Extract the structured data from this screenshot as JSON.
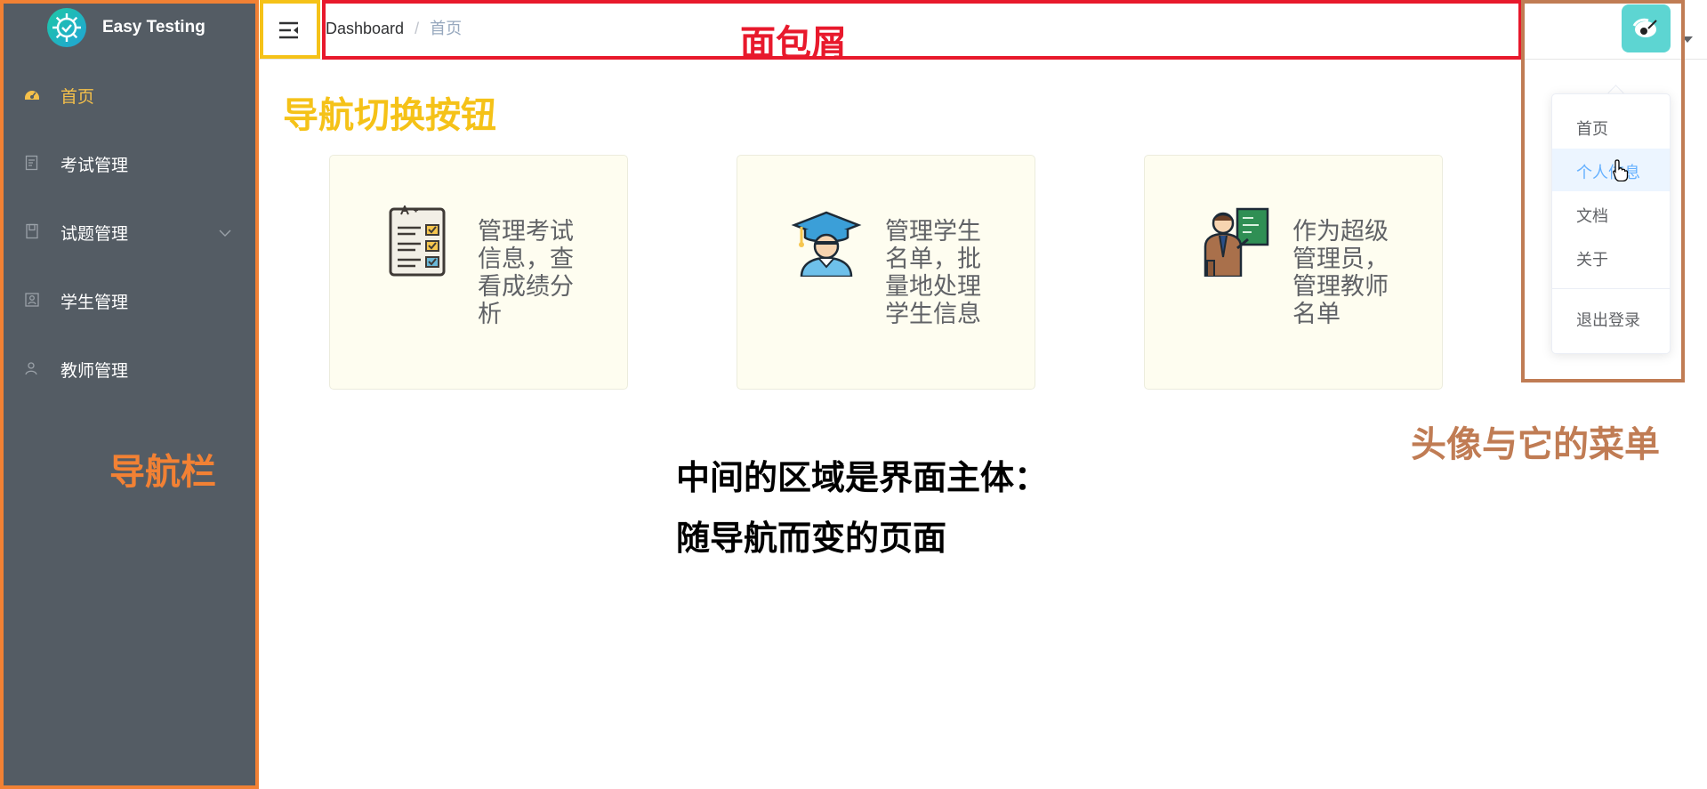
{
  "sidebar": {
    "brand": {
      "title": "Easy Testing"
    },
    "items": [
      {
        "label": "首页",
        "icon": "dashboard-icon",
        "active": true
      },
      {
        "label": "考试管理",
        "icon": "exam-icon"
      },
      {
        "label": "试题管理",
        "icon": "question-bank-icon",
        "has_submenu": true
      },
      {
        "label": "学生管理",
        "icon": "student-icon"
      },
      {
        "label": "教师管理",
        "icon": "teacher-icon"
      }
    ]
  },
  "header": {
    "breadcrumb": {
      "root": "Dashboard",
      "separator": "/",
      "current": "首页"
    },
    "toggle_icon": "menu-fold-icon",
    "avatar_icon": "avatar-icon"
  },
  "dropdown": {
    "items": [
      {
        "label": "首页"
      },
      {
        "label": "个人信息",
        "hover": true
      },
      {
        "label": "文档"
      },
      {
        "label": "关于"
      },
      {
        "label": "退出登录"
      }
    ]
  },
  "cards": [
    {
      "text": "管理考试信息，查看成绩分析",
      "icon": "exam-paper-icon"
    },
    {
      "text": "管理学生名单，批量地处理学生信息",
      "icon": "graduate-student-icon"
    },
    {
      "text": "作为超级管理员，管理教师名单",
      "icon": "teacher-presenting-icon"
    }
  ],
  "main": {
    "line1": "中间的区域是界面主体：",
    "line2": "随导航而变的页面"
  },
  "annotations": {
    "breadcrumb": {
      "label": "面包屑",
      "color": "#e8192c"
    },
    "toggle": {
      "label": "导航切换按钮",
      "color": "#f5c218"
    },
    "sidebar": {
      "label": "导航栏",
      "color": "#f28134"
    },
    "avatar": {
      "label": "头像与它的菜单",
      "color": "#c07c54"
    }
  },
  "colors": {
    "sidebar_bg": "#545c64",
    "sidebar_active": "#f5c04a",
    "card_bg": "#fefdf0",
    "dropdown_hover": "#66b1ff"
  }
}
